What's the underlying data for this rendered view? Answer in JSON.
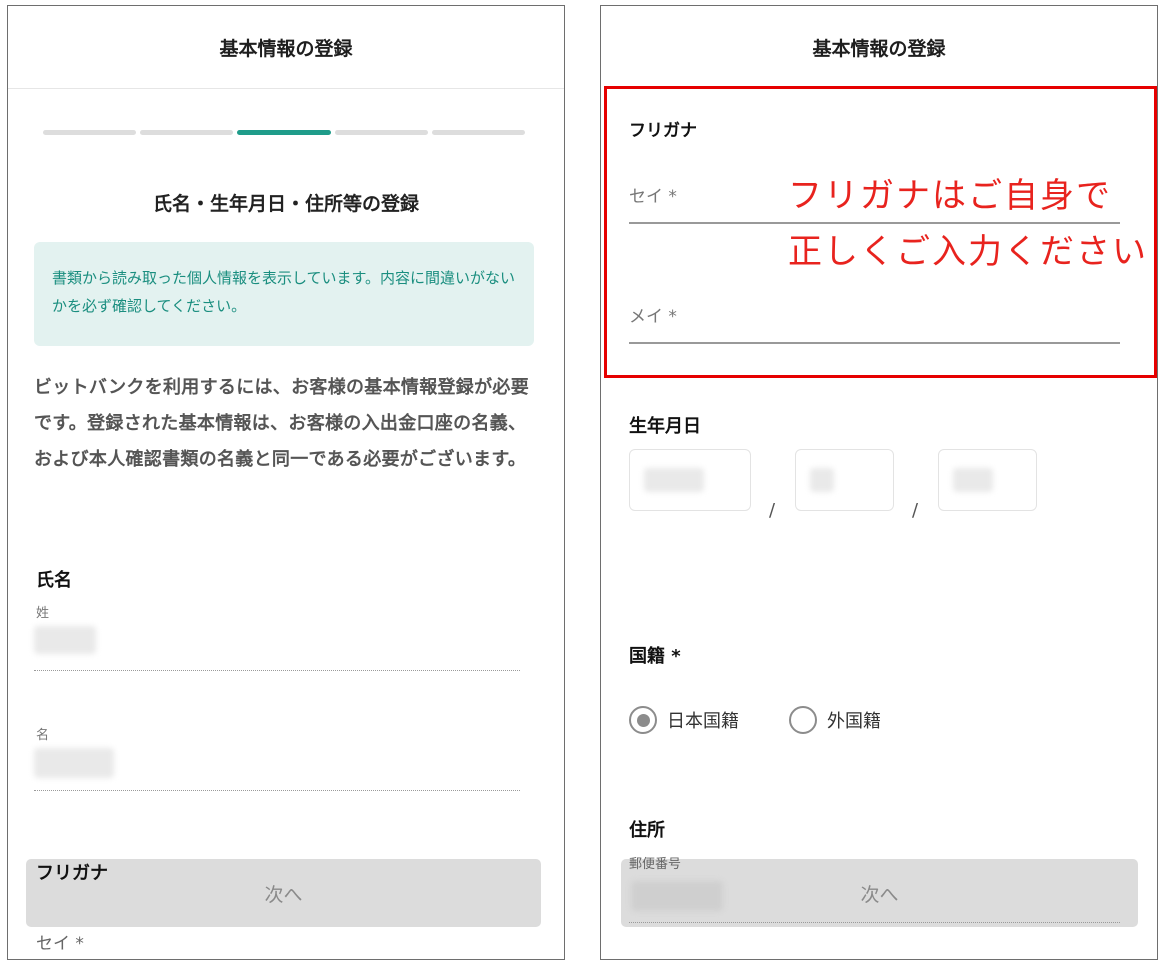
{
  "left": {
    "header_title": "基本情報の登録",
    "progress": {
      "total_steps": 5,
      "current_step": 3
    },
    "section_title": "氏名・生年月日・住所等の登録",
    "notice": "書類から読み取った個人情報を表示しています。内容に間違いがないかを必ず確認してください。",
    "description": "ビットバンクを利用するには、お客様の基本情報登録が必要です。登録された基本情報は、お客様の入出金口座の名義、および本人確認書類の名義と同一である必要がございます。",
    "name_section_label": "氏名",
    "last_name_label": "姓",
    "first_name_label": "名",
    "furigana_label": "フリガナ",
    "sei_label": "セイ *",
    "next_button": "次へ"
  },
  "right": {
    "header_title": "基本情報の登録",
    "furigana_label": "フリガナ",
    "sei_placeholder": "セイ *",
    "mei_placeholder": "メイ *",
    "annotation_line1": "フリガナはご自身で",
    "annotation_line2": "正しくご入力ください",
    "birthdate_label": "生年月日",
    "date_separator": "/",
    "nationality_label": "国籍 *",
    "nationality_options": [
      "日本国籍",
      "外国籍"
    ],
    "nationality_selected": "日本国籍",
    "address_label": "住所",
    "postal_label": "郵便番号",
    "next_button": "次へ"
  },
  "colors": {
    "accent": "#1f9c8a",
    "notice_bg": "#e3f2f0",
    "annotation_red": "#e8231e"
  }
}
